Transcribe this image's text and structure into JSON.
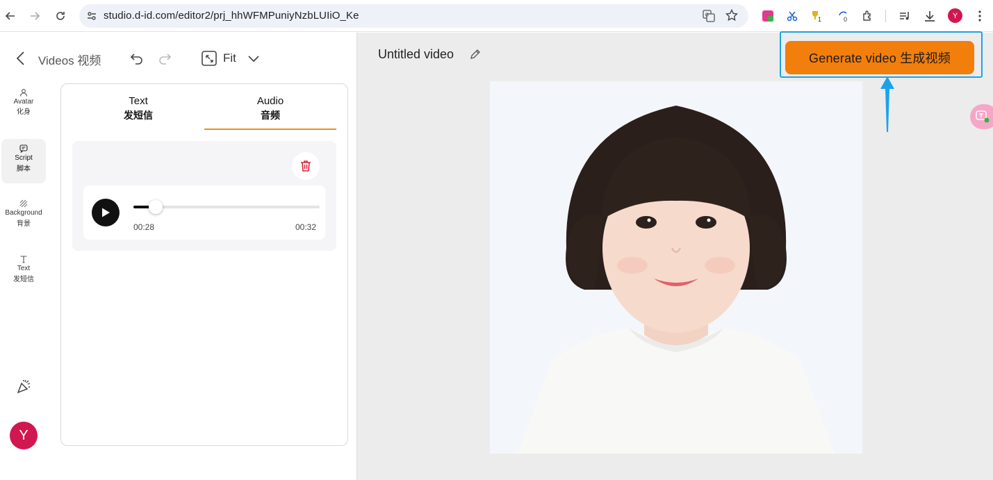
{
  "browser": {
    "url": "studio.d-id.com/editor2/prj_hhWFMPuniyNzbLUIiO_Ke",
    "profile_initial": "Y",
    "ext_badge_1": "1",
    "ext_badge_2": "0"
  },
  "panel": {
    "title": "Videos 视频",
    "zoom_label": "Fit",
    "tabs": [
      {
        "label": "Text",
        "sublabel": "发短信"
      },
      {
        "label": "Audio",
        "sublabel": "音频"
      }
    ],
    "audio": {
      "current_time": "00:28",
      "duration": "00:32",
      "progress": 0.12
    }
  },
  "rail": {
    "items": [
      {
        "label": "Avatar",
        "sublabel": "化身",
        "icon": "person-icon"
      },
      {
        "label": "Script",
        "sublabel": "脚本",
        "icon": "chat-icon"
      },
      {
        "label": "Background",
        "sublabel": "背景",
        "icon": "pattern-icon"
      },
      {
        "label": "Text",
        "sublabel": "发短信",
        "icon": "text-icon"
      }
    ],
    "avatar_initial": "Y"
  },
  "canvas": {
    "video_title": "Untitled video",
    "generate_label": "Generate video  生成视频"
  },
  "colors": {
    "accent": "#f27e0c",
    "highlight": "#1aa3ea",
    "avatar": "#d1174f"
  }
}
